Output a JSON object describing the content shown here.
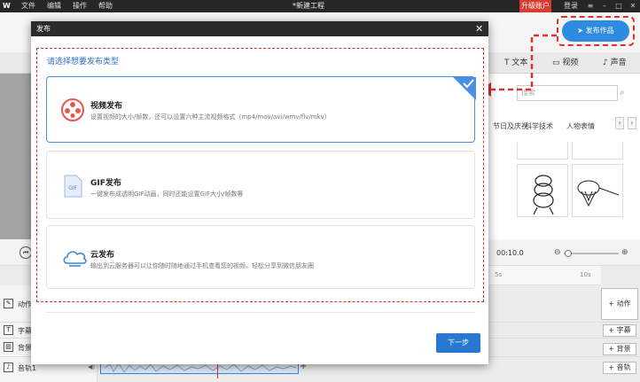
{
  "titlebar": {
    "logo": "W",
    "menu": [
      "文件",
      "编辑",
      "操作",
      "帮助"
    ],
    "title": "*新建工程",
    "upgrade": "升级账户",
    "login": "登录"
  },
  "toolbar": {
    "publish_work": "发布作品"
  },
  "tabs": {
    "text": "文本",
    "video": "视频",
    "sound": "声音"
  },
  "right_panel": {
    "search_placeholder": "搜索",
    "categories": [
      "节日及庆祝",
      "科学技术",
      "人物表情"
    ]
  },
  "controls": {
    "time": "00:10.0"
  },
  "ruler": [
    "5s",
    "10s"
  ],
  "tracks": {
    "action": "动作",
    "subtitle": "字幕",
    "background": "背景",
    "audio": "音轨1",
    "add_action": "+ 动作",
    "add_subtitle": "+ 字幕",
    "add_background": "+ 背景",
    "add_audio": "+ 音轨",
    "add_clip": "+"
  },
  "dialog": {
    "title": "发布",
    "prompt": "请选择想要发布类型",
    "options": [
      {
        "title": "视频发布",
        "desc": "设置视频的大小/帧数，还可以设置六种主流视频格式（mp4/mov/avi/wmv/flv/mkv）",
        "icon": "film-reel-icon",
        "selected": true
      },
      {
        "title": "GIF发布",
        "desc": "一键发布成透明GIF动画，同时还能设置GIF大小/帧数等",
        "icon": "gif-file-icon",
        "selected": false
      },
      {
        "title": "云发布",
        "desc": "输出到云服务器可以让你随时随地通过手机查看您的视频，轻松分享到微信朋友圈",
        "icon": "cloud-icon",
        "selected": false
      }
    ],
    "gif_icon_text": "GIF",
    "next": "下一步"
  },
  "colors": {
    "accent": "#2e8be0",
    "highlight": "#e03030",
    "header": "#2b2b2b"
  }
}
